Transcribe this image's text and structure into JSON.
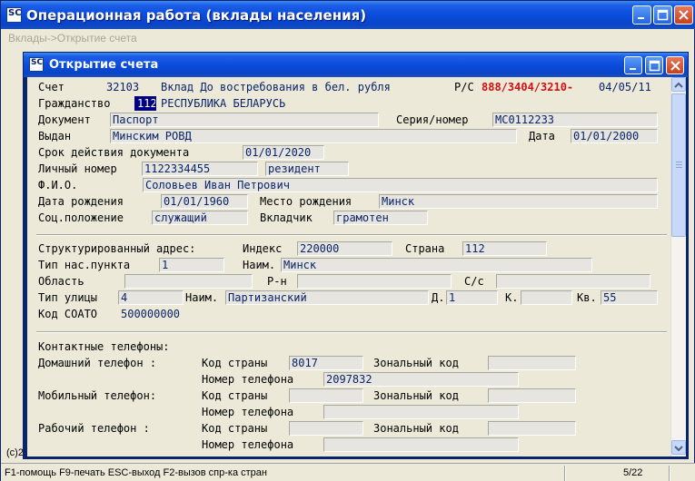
{
  "window": {
    "title": "Операционная работа (вклады населения)",
    "breadcrumb": "Вклады->Открытие счета",
    "app_icon": "SC",
    "copyright": "(c)2"
  },
  "dialog": {
    "title": "Открытие счета",
    "app_icon": "SC"
  },
  "account": {
    "schet_label": "Счет",
    "schet_value": "32103",
    "vklad_title": "Вклад До востребования в бел. рубля",
    "rs_label": "Р/С",
    "rs_value": "888/3404/3210-",
    "date_value": "04/05/11"
  },
  "citizen": {
    "grazhd_label": "Гражданство",
    "grazhd_code": "112",
    "grazhd_name": "РЕСПУБЛИКА БЕЛАРУСЬ",
    "doc_label": "Документ",
    "doc_value": "Паспорт",
    "series_label": "Серия/номер",
    "series_value": "МС0112233",
    "issued_label": "Выдан",
    "issued_value": "Минским РОВД",
    "issue_date_label": "Дата",
    "issue_date_value": "01/01/2000",
    "validity_label": "Срок действия документа",
    "validity_value": "01/01/2020",
    "personal_label": "Личный номер",
    "personal_value": "1122334455",
    "resident_value": "резидент",
    "fio_label": "Ф.И.О.",
    "fio_value": "Соловьев Иван Петрович",
    "birth_label": "Дата рождения",
    "birth_value": "01/01/1960",
    "birthplace_label": "Место рождения",
    "birthplace_value": "Минск",
    "social_label": "Соц.положение",
    "social_value": "служащий",
    "depositor_label": "Вкладчик",
    "depositor_value": "грамотен"
  },
  "address": {
    "struct_label": "Структурированный адрес:",
    "index_label": "Индекс",
    "index_value": "220000",
    "country_label": "Страна",
    "country_value": "112",
    "settlement_type_label": "Тип нас.пункта",
    "settlement_type_value": "1",
    "settlement_name_label": "Наим.",
    "settlement_name_value": "Минск",
    "region_label": "Область",
    "region_value": "",
    "district_label": "Р-н",
    "district_value": "",
    "ss_label": "С/с",
    "ss_value": "",
    "street_type_label": "Тип улицы",
    "street_type_value": "4",
    "street_name_label": "Наим.",
    "street_name_value": "Партизанский",
    "house_label": "Д.",
    "house_value": "1",
    "korpus_label": "К.",
    "korpus_value": "",
    "apt_label": "Кв.",
    "apt_value": "55",
    "soato_label": "Код СОАТО",
    "soato_value": "500000000"
  },
  "contacts": {
    "heading": "Контактные телефоны:",
    "home_label": "Домашний телефон :",
    "mobile_label": "Мобильный телефон:",
    "work_label": "Рабочий телефон :",
    "country_code_label": "Код страны",
    "zonal_code_label": "Зональный код",
    "phone_number_label": "Номер телефона",
    "home_country_code": "8017",
    "home_zonal_code": "",
    "home_number": "2097832",
    "mobile_country_code": "",
    "mobile_zonal_code": "",
    "mobile_number": "",
    "work_country_code": "",
    "work_zonal_code": "",
    "work_number": ""
  },
  "status": {
    "keys": "F1-помощь  F9-печать ESC-выход F2-вызов спр-ка стран",
    "pager": "5/22"
  },
  "colors": {
    "titlebar": "#0a4cdc",
    "field_text": "#0a246a",
    "account_red": "#d01010",
    "selection": "#000080"
  }
}
